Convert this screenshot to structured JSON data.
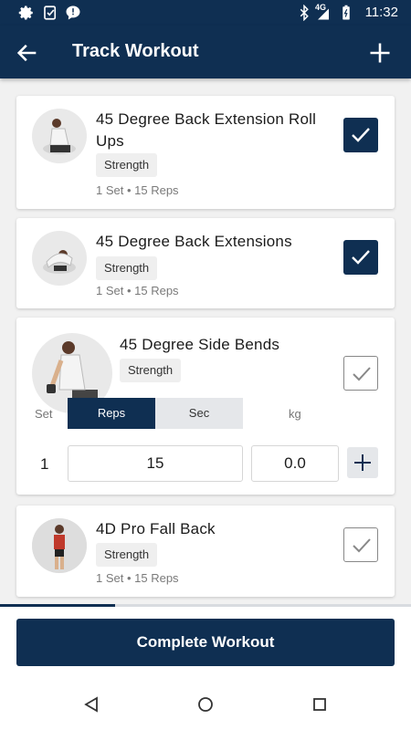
{
  "status_bar": {
    "time": "11:32",
    "network": "4G"
  },
  "app_bar": {
    "title": "Track Workout"
  },
  "exercises": [
    {
      "name": "45 Degree Back Extension Roll Ups",
      "tag": "Strength",
      "meta": "1 Set • 15 Reps",
      "completed": true
    },
    {
      "name": "45 Degree Back Extensions",
      "tag": "Strength",
      "meta": "1 Set • 15 Reps",
      "completed": true
    },
    {
      "name": "45 Degree Side Bends",
      "tag": "Strength",
      "completed": false,
      "set_editor": {
        "set_label": "Set",
        "unit_options": [
          "Reps",
          "Sec"
        ],
        "selected_unit": "Reps",
        "weight_label": "kg",
        "rows": [
          {
            "set": "1",
            "reps": "15",
            "weight": "0.0"
          }
        ]
      }
    },
    {
      "name": "4D Pro Fall Back",
      "tag": "Strength",
      "meta": "1 Set • 15 Reps",
      "completed": false
    }
  ],
  "progress": 0.28,
  "footer": {
    "complete_label": "Complete Workout"
  },
  "colors": {
    "primary": "#0f2f52",
    "background": "#f1f1f1"
  }
}
